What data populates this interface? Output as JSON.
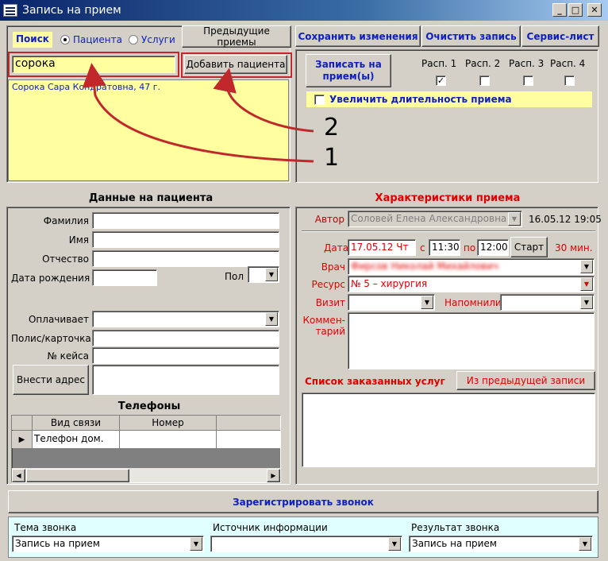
{
  "window": {
    "title": "Запись на прием",
    "btn_min": "_",
    "btn_max": "□",
    "btn_close": "✕"
  },
  "search": {
    "label": "Поиск",
    "opt_patients": "Пациента",
    "opt_services": "Услуги",
    "value": "сорока",
    "add_patient": "Добавить пациента",
    "prev_visits": "Предыдущие приемы",
    "result": "Сорока Сара Кондратовна, 47 г."
  },
  "toolbar": {
    "save": "Сохранить изменения",
    "clear": "Очистить запись",
    "service": "Сервис-лист"
  },
  "appointment": {
    "book_button": "Записать на прием(ы)",
    "schedules": [
      "Расп. 1",
      "Расп. 2",
      "Расп. 3",
      "Расп. 4"
    ],
    "schedule_checked": [
      true,
      false,
      false,
      false
    ],
    "extend": "Увеличить длительность приема"
  },
  "annotations": {
    "one": "1",
    "two": "2"
  },
  "patient": {
    "header": "Данные на пациента",
    "last_name": "Фамилия",
    "first_name": "Имя",
    "patronymic": "Отчество",
    "birth": "Дата рождения",
    "sex": "Пол",
    "payer": "Оплачивает",
    "policy": "Полис/карточка",
    "case_no": "№ кейса",
    "address_button": "Внести адрес",
    "phones_header": "Телефоны",
    "phone_cols": [
      "Вид связи",
      "Номер"
    ],
    "phone_rows": [
      [
        "Телефон дом.",
        ""
      ]
    ]
  },
  "characteristics": {
    "header": "Характеристики приема",
    "author_label": "Автор",
    "author": "Соловей Елена Александровна",
    "created": "16.05.12 19:05",
    "date_label": "Дата",
    "date": "17.05.12 Чт",
    "from_label": "с",
    "from": "11:30",
    "to_label": "по",
    "to": "12:00",
    "start": "Старт",
    "duration": "30 мин.",
    "doctor_label": "Врач",
    "doctor": "Фирсов Николай Михайлович",
    "resource_label": "Ресурс",
    "resource": "№ 5 – хирургия",
    "visit_label": "Визит",
    "remind_label": "Напомнили",
    "comment_label_1": "Коммен-",
    "comment_label_2": "тарий",
    "services_header": "Список заказанных услуг",
    "from_prev": "Из предыдущей записи"
  },
  "call": {
    "register": "Зарегистрировать звонок",
    "topic_label": "Тема звонка",
    "topic": "Запись на прием",
    "source_label": "Источник информации",
    "source": "",
    "result_label": "Результат звонка",
    "result": "Запись на прием"
  },
  "colors": {
    "accent_blue": "#1020c0",
    "accent_red": "#e00000",
    "highlight_yellow": "#ffffa0",
    "annotation_red": "#c0282b"
  }
}
